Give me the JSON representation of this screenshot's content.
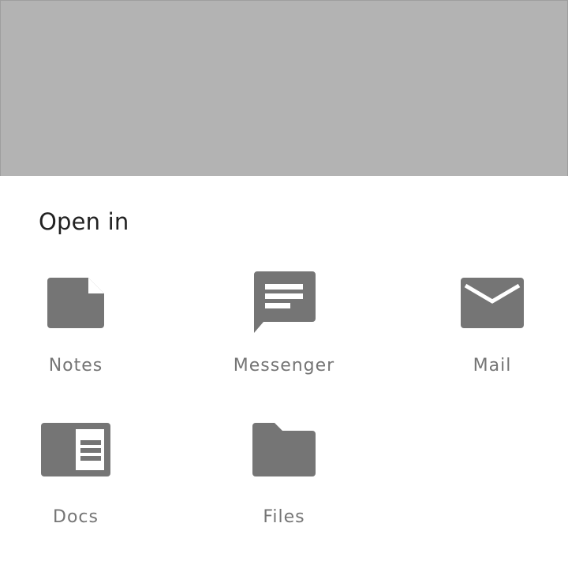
{
  "sheet": {
    "title": "Open in",
    "targets": [
      {
        "label": "Notes",
        "icon": "note-icon"
      },
      {
        "label": "Messenger",
        "icon": "message-icon"
      },
      {
        "label": "Mail",
        "icon": "mail-icon"
      },
      {
        "label": "Docs",
        "icon": "document-icon"
      },
      {
        "label": "Files",
        "icon": "folder-icon"
      }
    ]
  },
  "colors": {
    "scrim": "#b3b3b3",
    "icon": "#757575",
    "title": "#212121",
    "label": "#757575"
  }
}
